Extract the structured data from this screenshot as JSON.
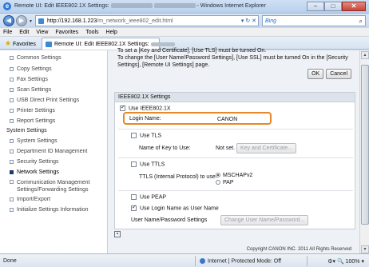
{
  "window": {
    "title_prefix": "Remote UI: Edit IEEE802.1X Settings:",
    "title_suffix": "- Windows Internet Explorer"
  },
  "address": {
    "url_host": "http://192.168.1.223",
    "url_path": "/m_network_ieee802_edit.html",
    "search_placeholder": "Bing"
  },
  "menu": [
    "File",
    "Edit",
    "View",
    "Favorites",
    "Tools",
    "Help"
  ],
  "favorites": {
    "label": "Favorites",
    "tab_label": "Remote UI: Edit IEEE802.1X Settings:"
  },
  "sidebar": {
    "items": [
      {
        "label": "Common Settings"
      },
      {
        "label": "Copy Settings"
      },
      {
        "label": "Fax Settings"
      },
      {
        "label": "Scan Settings"
      },
      {
        "label": "USB Direct Print Settings"
      },
      {
        "label": "Printer Settings"
      },
      {
        "label": "Report Settings"
      }
    ],
    "system_header": "System Settings",
    "system_items": [
      {
        "label": "System Settings"
      },
      {
        "label": "Department ID Management"
      },
      {
        "label": "Security Settings"
      },
      {
        "label": "Network Settings"
      },
      {
        "label": "Communication Management"
      },
      {
        "label": "Settings/Forwarding Settings"
      },
      {
        "label": "Import/Export"
      },
      {
        "label": "Initialize Settings Information"
      }
    ]
  },
  "message": {
    "line1": "To set a [Key and Certificate], [Use TLS] must be turned On.",
    "line2": "To change the [User Name/Password Settings], [Use SSL] must be turned On in the [Security",
    "line3": "Settings], [Remote UI Settings] page.",
    "ok": "OK",
    "cancel": "Cancel"
  },
  "ieee": {
    "header": "IEEE802.1X Settings",
    "use_ieee": "Use IEEE802.1X",
    "login_label": "Login Name:",
    "login_value": "CANON",
    "use_tls": "Use TLS",
    "key_name_label": "Name of Key to Use:",
    "key_name_value": "Not set.",
    "key_button": "Key and Certificate...",
    "use_ttls": "Use TTLS",
    "ttls_protocol_label": "TTLS (Internal Protocol) to use:",
    "mschapv2": "MSCHAPv2",
    "pap": "PAP",
    "use_peap": "Use PEAP",
    "use_login_as_user": "Use Login Name as User Name",
    "user_pass_label": "User Name/Password Settings",
    "user_pass_button": "Change User Name/Password..."
  },
  "footer": {
    "copyright": "Copyright CANON INC. 2011 All Rights Reserved"
  },
  "status": {
    "done": "Done",
    "zone": "Internet | Protected Mode: Off",
    "zoom": "100%"
  }
}
